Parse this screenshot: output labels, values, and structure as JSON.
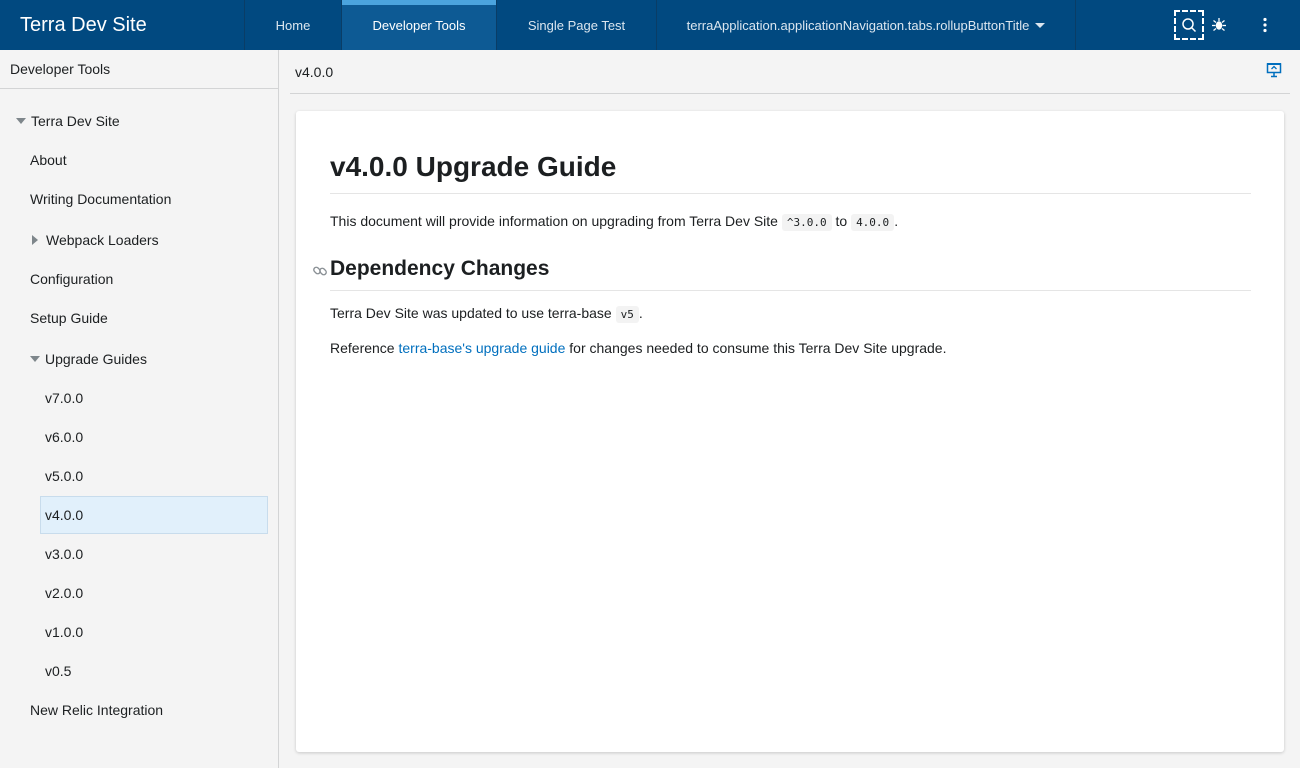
{
  "header": {
    "brand": "Terra Dev Site",
    "tabs": [
      {
        "label": "Home"
      },
      {
        "label": "Developer Tools"
      },
      {
        "label": "Single Page Test"
      },
      {
        "label": "terraApplication.applicationNavigation.tabs.rollupButtonTitle"
      }
    ],
    "actions": {
      "search_icon": "search-icon",
      "bug_icon": "bug-icon",
      "more_icon": "more-vertical-icon"
    }
  },
  "sidebar": {
    "title": "Developer Tools",
    "items": [
      {
        "label": "Terra Dev Site"
      },
      {
        "label": "About"
      },
      {
        "label": "Writing Documentation"
      },
      {
        "label": "Webpack Loaders"
      },
      {
        "label": "Configuration"
      },
      {
        "label": "Setup Guide"
      },
      {
        "label": "Upgrade Guides"
      },
      {
        "label": "v7.0.0"
      },
      {
        "label": "v6.0.0"
      },
      {
        "label": "v5.0.0"
      },
      {
        "label": "v4.0.0"
      },
      {
        "label": "v3.0.0"
      },
      {
        "label": "v2.0.0"
      },
      {
        "label": "v1.0.0"
      },
      {
        "label": "v0.5"
      },
      {
        "label": "New Relic Integration"
      }
    ]
  },
  "main": {
    "version": "v4.0.0",
    "doc": {
      "title": "v4.0.0 Upgrade Guide",
      "intro_before": "This document will provide information on upgrading from Terra Dev Site ",
      "intro_code1": "^3.0.0",
      "intro_mid": " to ",
      "intro_code2": "4.0.0",
      "intro_after": ".",
      "section_title": "Dependency Changes",
      "dep_before": "Terra Dev Site was updated to use terra-base ",
      "dep_code": "v5",
      "dep_after": ".",
      "ref_before": "Reference ",
      "ref_link": "terra-base's upgrade guide",
      "ref_after": " for changes needed to consume this Terra Dev Site upgrade."
    }
  },
  "colors": {
    "header_bg": "#014980",
    "active_tab_bg": "#0d5a94",
    "active_tab_indicator": "#4ba4de",
    "selected_item_bg": "#e1f0fb",
    "link": "#006fbe"
  }
}
